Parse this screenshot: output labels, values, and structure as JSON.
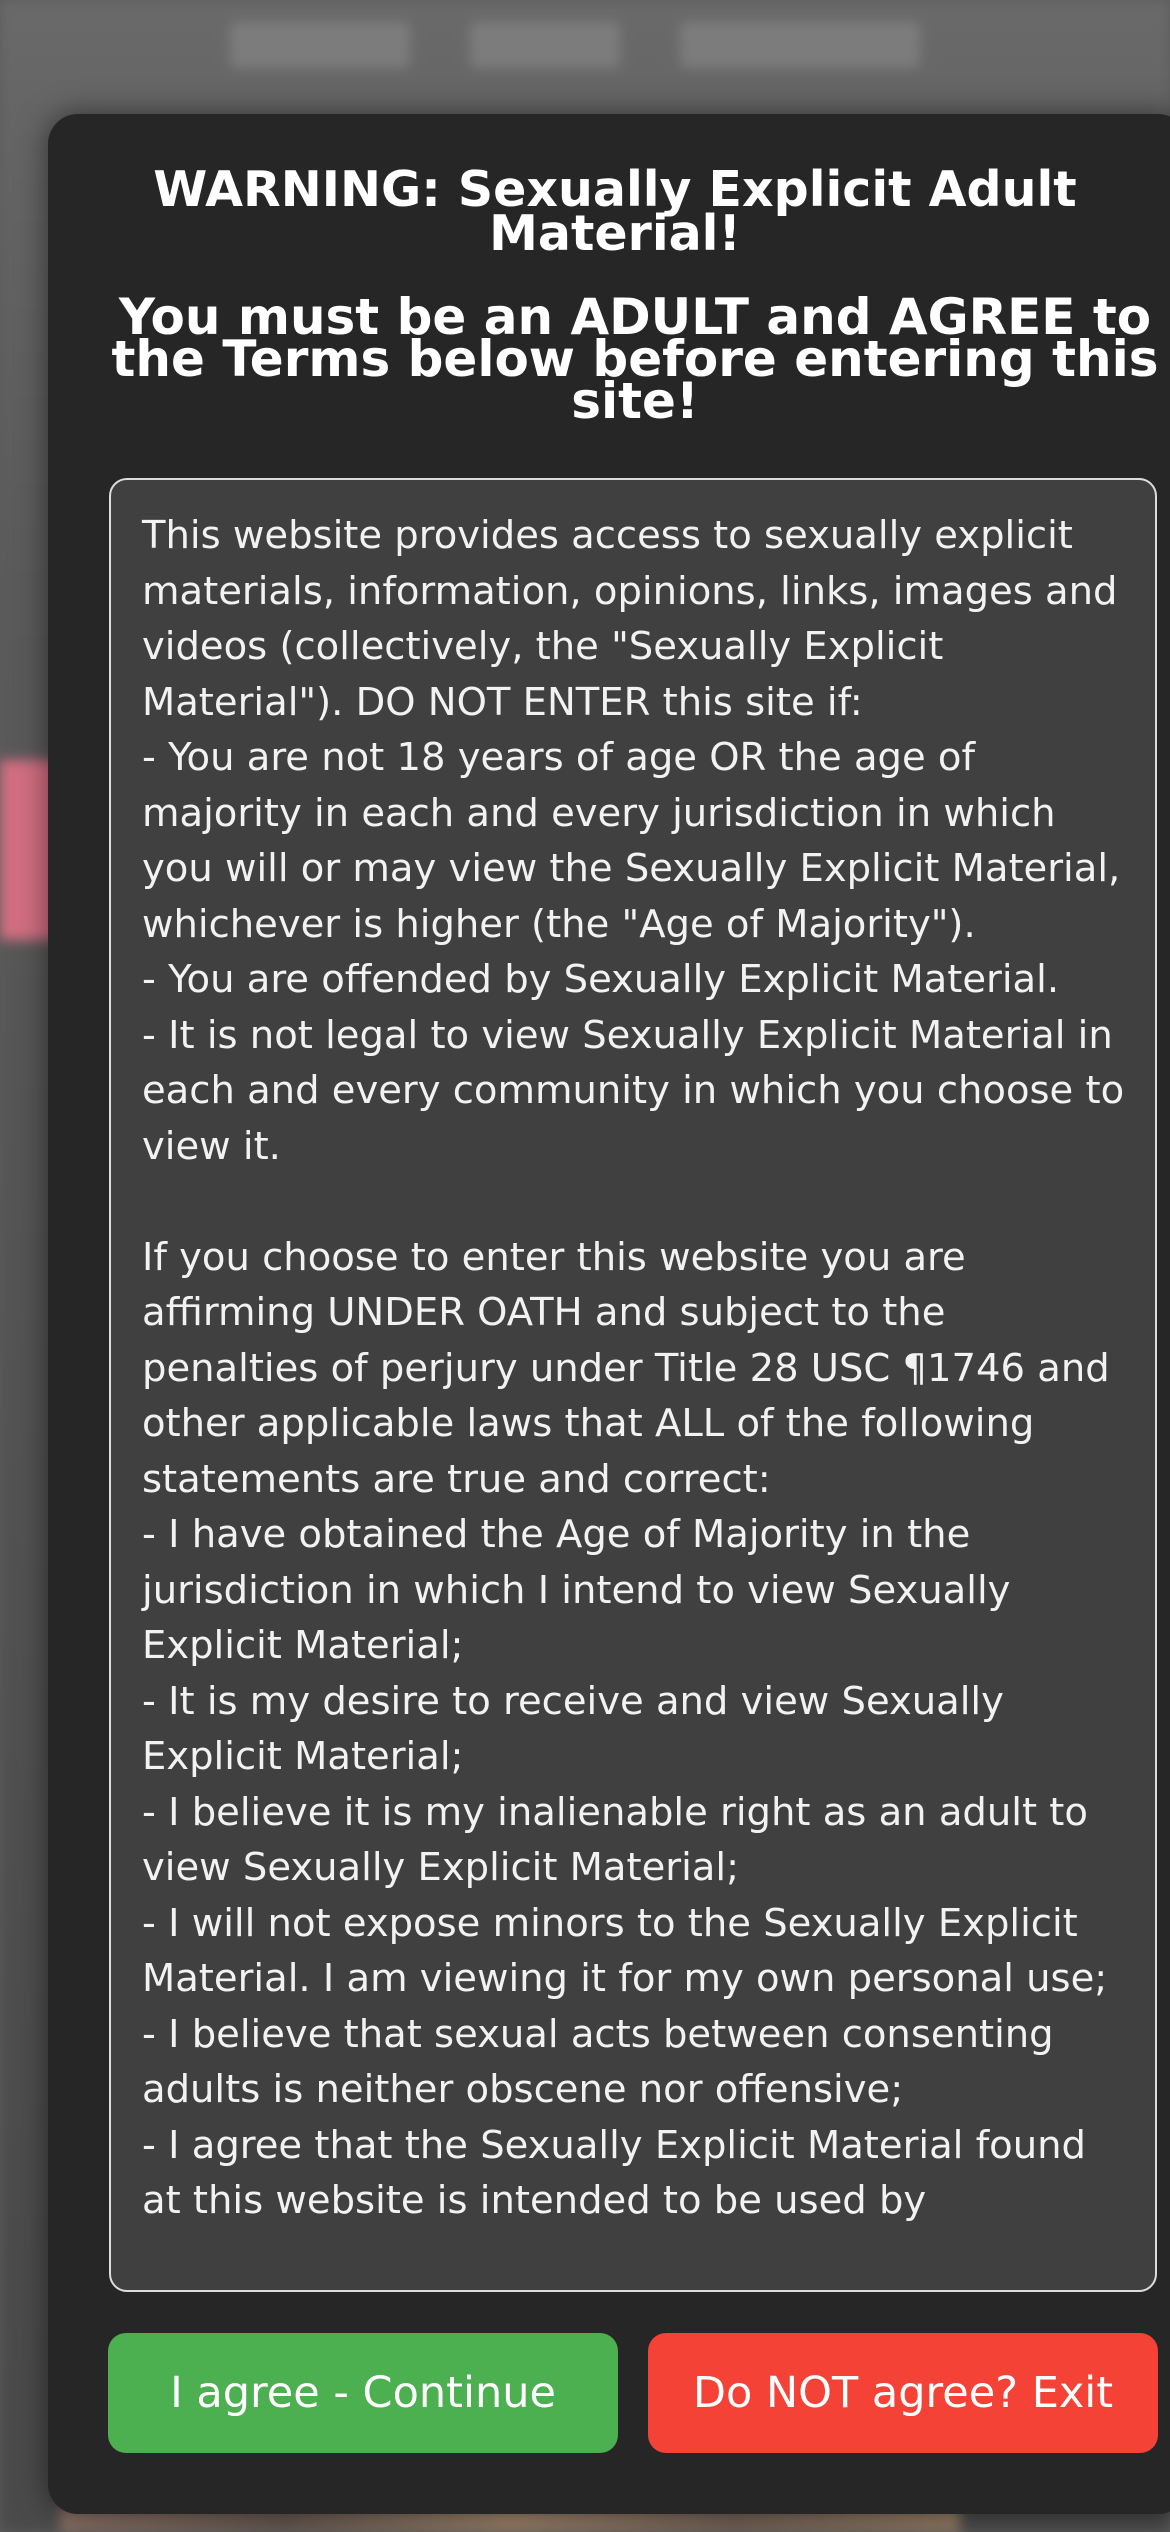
{
  "modal": {
    "heading_line1": "WARNING: Sexually Explicit Adult Material!",
    "heading_line2": "You must be an ADULT and AGREE to the Terms below before entering this site!",
    "terms_text": "This website provides access to sexually explicit materials, information, opinions, links, images and videos (collectively, the \"Sexually Explicit Material\"). DO NOT ENTER this site if:\n- You are not 18 years of age OR the age of majority in each and every jurisdiction in which you will or may view the Sexually Explicit Material, whichever is higher (the \"Age of Majority\").\n- You are offended by Sexually Explicit Material.\n- It is not legal to view Sexually Explicit Material in each and every community in which you choose to view it.\n\nIf you choose to enter this website you are affirming UNDER OATH and subject to the penalties of perjury under Title 28 USC ¶1746 and other applicable laws that ALL of the following statements are true and correct:\n- I have obtained the Age of Majority in the jurisdiction in which I intend to view Sexually Explicit Material;\n- It is my desire to receive and view Sexually Explicit Material;\n- I believe it is my inalienable right as an adult to view Sexually Explicit Material;\n- I will not expose minors to the Sexually Explicit Material. I am viewing it for my own personal use;\n- I believe that sexual acts between consenting adults is neither obscene nor offensive;\n- I agree that the Sexually Explicit Material found at this website is intended to be used by",
    "agree_button": "I agree - Continue",
    "exit_button": "Do NOT agree? Exit"
  },
  "colors": {
    "modal_bg": "#262626",
    "terms_bg": "#404040",
    "agree_green": "#4caf50",
    "exit_red": "#f44336"
  }
}
